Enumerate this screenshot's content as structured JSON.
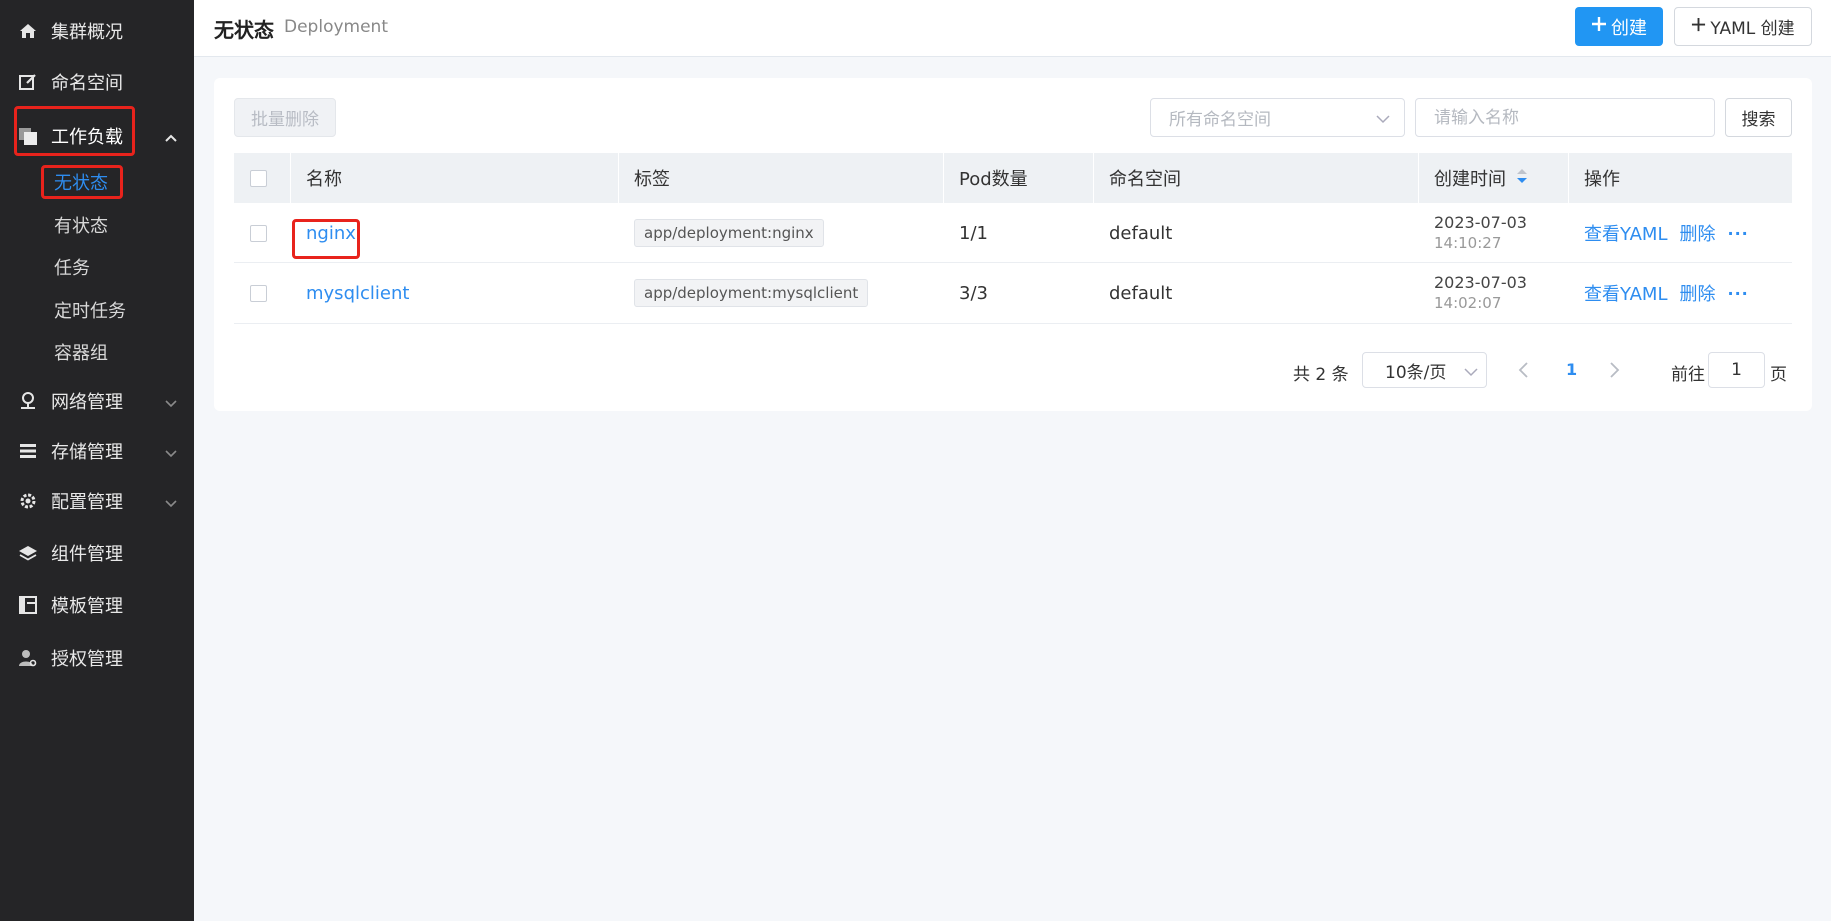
{
  "sidebar": {
    "items": [
      {
        "label": "集群概况",
        "icon": "home-icon"
      },
      {
        "label": "命名空间",
        "icon": "edit-icon"
      },
      {
        "label": "工作负载",
        "icon": "workload-icon",
        "expanded": true
      },
      {
        "label": "网络管理",
        "icon": "network-icon"
      },
      {
        "label": "存储管理",
        "icon": "storage-icon"
      },
      {
        "label": "配置管理",
        "icon": "gear-icon"
      },
      {
        "label": "组件管理",
        "icon": "layers-icon"
      },
      {
        "label": "模板管理",
        "icon": "template-icon"
      },
      {
        "label": "授权管理",
        "icon": "user-key-icon"
      }
    ],
    "workload_sub": [
      "无状态",
      "有状态",
      "任务",
      "定时任务",
      "容器组"
    ],
    "active_sub": "无状态"
  },
  "header": {
    "title": "无状态",
    "subtitle": "Deployment",
    "create_label": "创建",
    "yaml_create_label": "YAML 创建"
  },
  "toolbar": {
    "batch_delete_label": "批量删除",
    "namespace_placeholder": "所有命名空间",
    "name_placeholder": "请输入名称",
    "search_label": "搜索"
  },
  "table": {
    "columns": [
      "名称",
      "标签",
      "Pod数量",
      "命名空间",
      "创建时间",
      "操作"
    ],
    "rows": [
      {
        "name": "nginx",
        "label": "app/deployment:nginx",
        "pods": "1/1",
        "namespace": "default",
        "date": "2023-07-03",
        "time": "14:10:27"
      },
      {
        "name": "mysqlclient",
        "label": "app/deployment:mysqlclient",
        "pods": "3/3",
        "namespace": "default",
        "date": "2023-07-03",
        "time": "14:02:07"
      }
    ],
    "actions": {
      "view_yaml": "查看YAML",
      "delete": "删除",
      "more": "···"
    }
  },
  "pagination": {
    "total_text": "共 2 条",
    "page_size": "10条/页",
    "current_page": "1",
    "goto_label": "前往",
    "goto_value": "1",
    "page_suffix": "页"
  },
  "colors": {
    "accent": "#2196f3",
    "sidebar_bg": "#252527",
    "highlight_box": "#e8231c"
  }
}
